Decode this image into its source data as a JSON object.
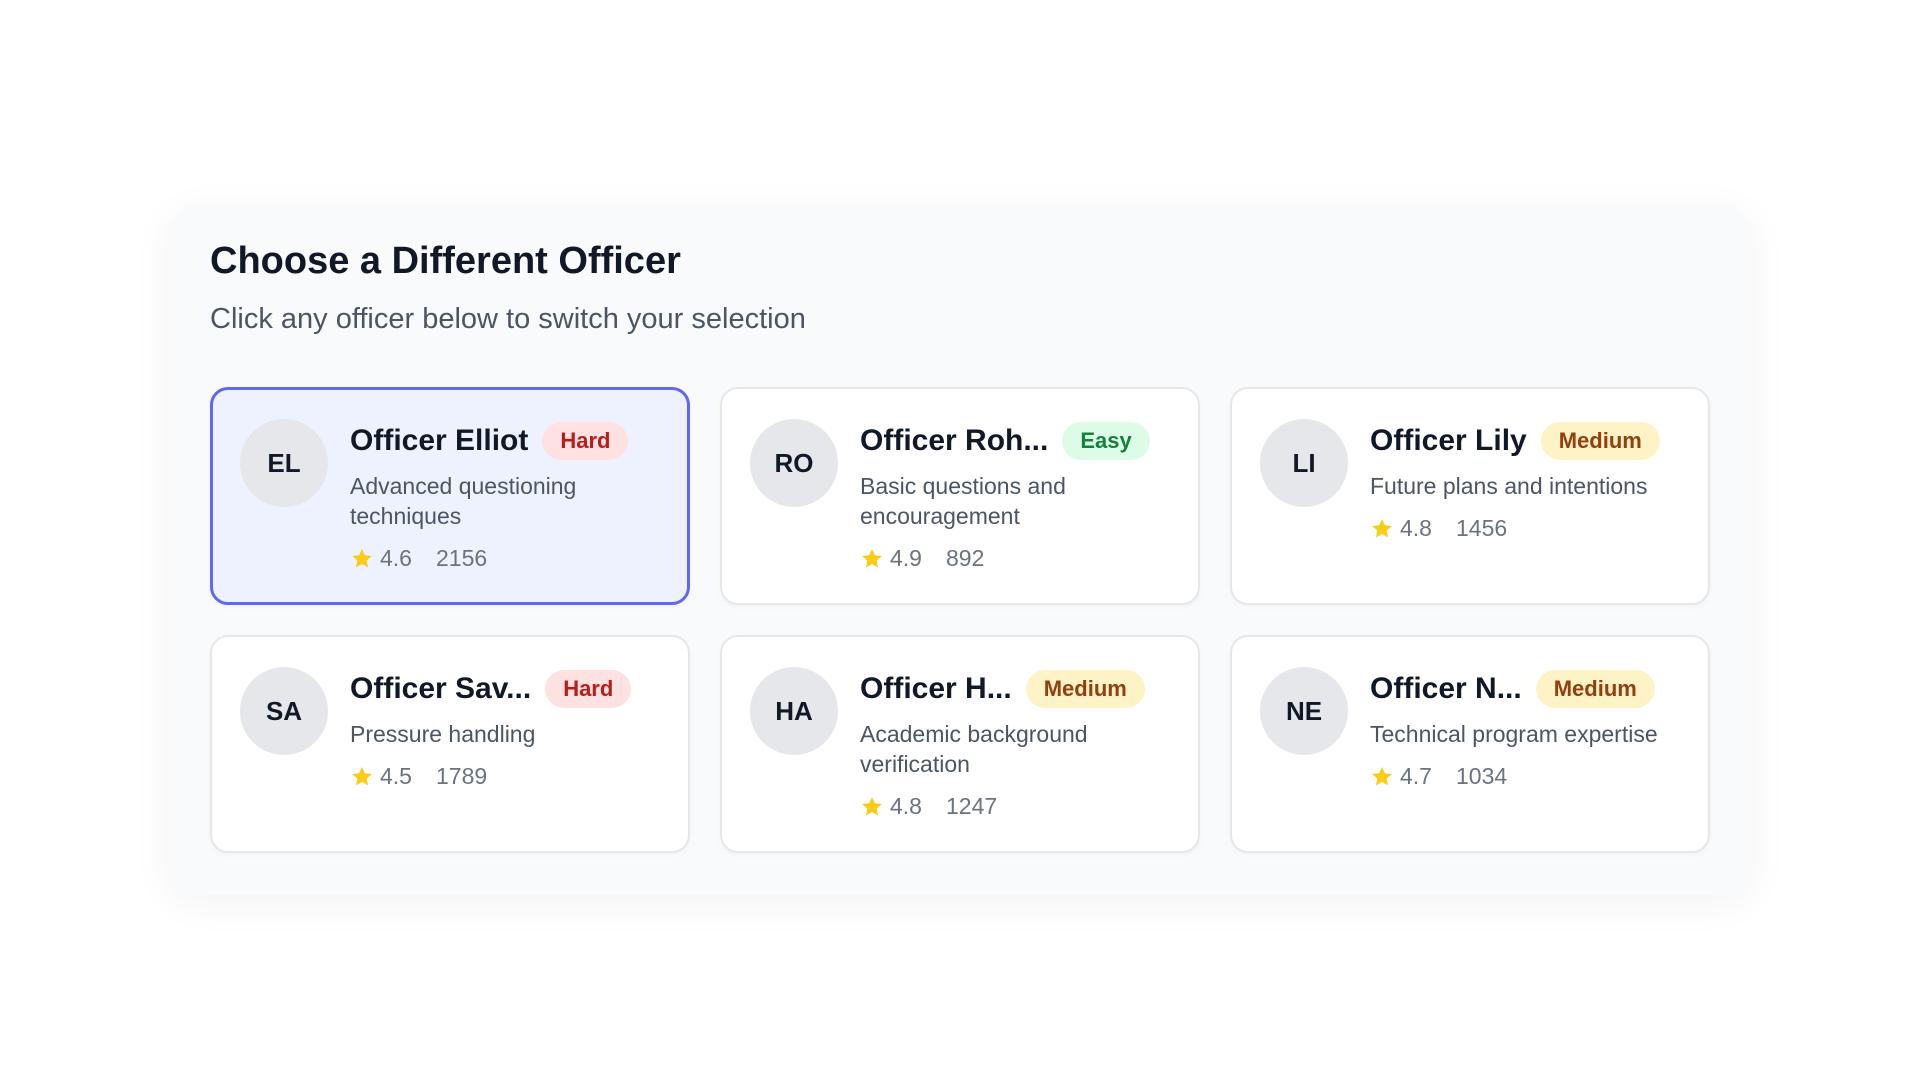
{
  "panel": {
    "title": "Choose a Different Officer",
    "subtitle": "Click any officer below to switch your selection"
  },
  "colors": {
    "selected_border": "#6366f1",
    "selected_background": "#eef2ff",
    "star": "#facc15",
    "hard_badge": "#fee2e2",
    "easy_badge": "#dcfce7",
    "medium_badge": "#fef3c7"
  },
  "officers": [
    {
      "initials": "EL",
      "name": "Officer Elliot",
      "difficulty": "Hard",
      "description": "Advanced questioning techniques",
      "rating": "4.6",
      "count": "2156",
      "selected": true
    },
    {
      "initials": "RO",
      "name": "Officer Roh...",
      "difficulty": "Easy",
      "description": "Basic questions and encouragement",
      "rating": "4.9",
      "count": "892",
      "selected": false
    },
    {
      "initials": "LI",
      "name": "Officer Lily",
      "difficulty": "Medium",
      "description": "Future plans and intentions",
      "rating": "4.8",
      "count": "1456",
      "selected": false
    },
    {
      "initials": "SA",
      "name": "Officer Sav...",
      "difficulty": "Hard",
      "description": "Pressure handling",
      "rating": "4.5",
      "count": "1789",
      "selected": false
    },
    {
      "initials": "HA",
      "name": "Officer H...",
      "difficulty": "Medium",
      "description": "Academic background verification",
      "rating": "4.8",
      "count": "1247",
      "selected": false
    },
    {
      "initials": "NE",
      "name": "Officer N...",
      "difficulty": "Medium",
      "description": "Technical program expertise",
      "rating": "4.7",
      "count": "1034",
      "selected": false
    }
  ]
}
